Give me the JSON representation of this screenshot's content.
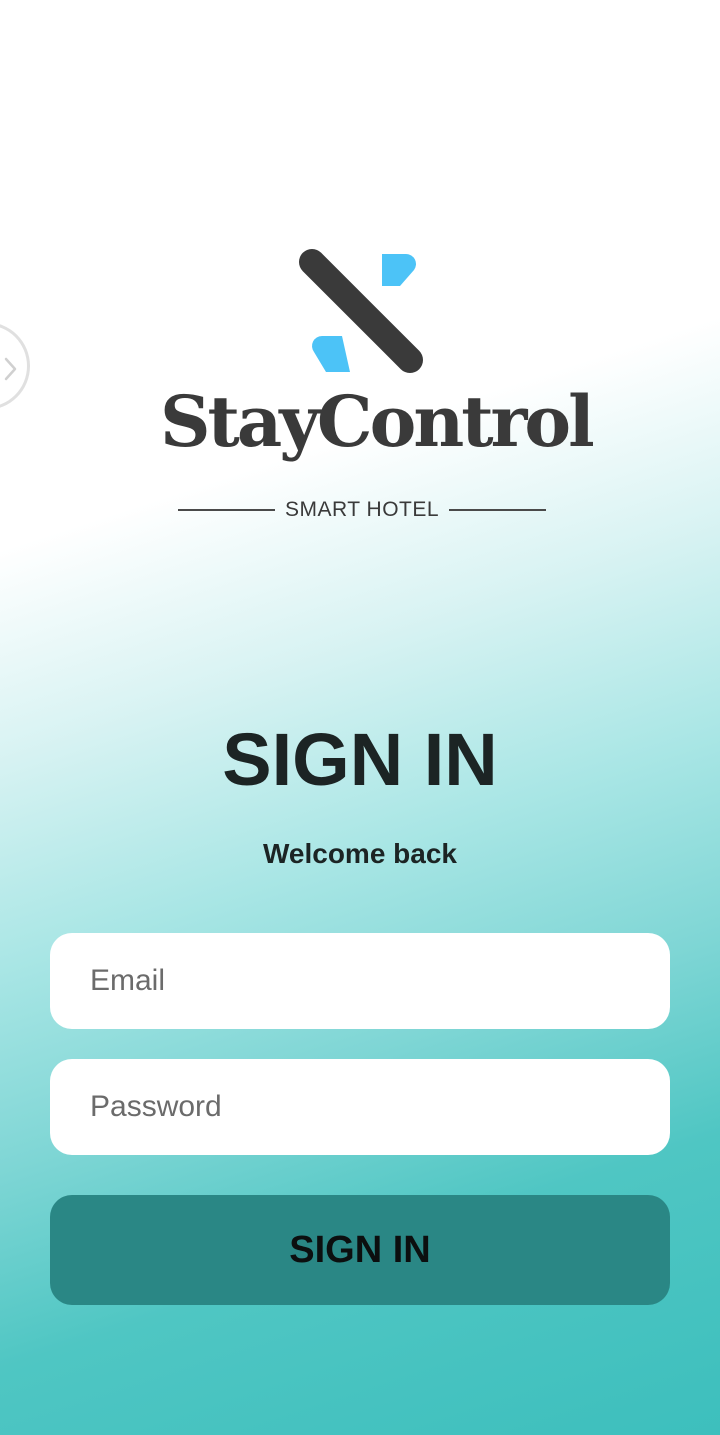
{
  "logo": {
    "wordmark": "StayControl",
    "tagline": "SMART HOTEL"
  },
  "colors": {
    "brand_dark": "#3a3a3a",
    "brand_blue": "#4cc3f7",
    "button": "#2a8785",
    "gradient_end": "#3dbfbd"
  },
  "form": {
    "title": "SIGN IN",
    "subtitle": "Welcome back",
    "email_placeholder": "Email",
    "password_placeholder": "Password",
    "submit_label": "SIGN IN"
  },
  "icons": {
    "edge_handle": "chevron-right-icon"
  }
}
